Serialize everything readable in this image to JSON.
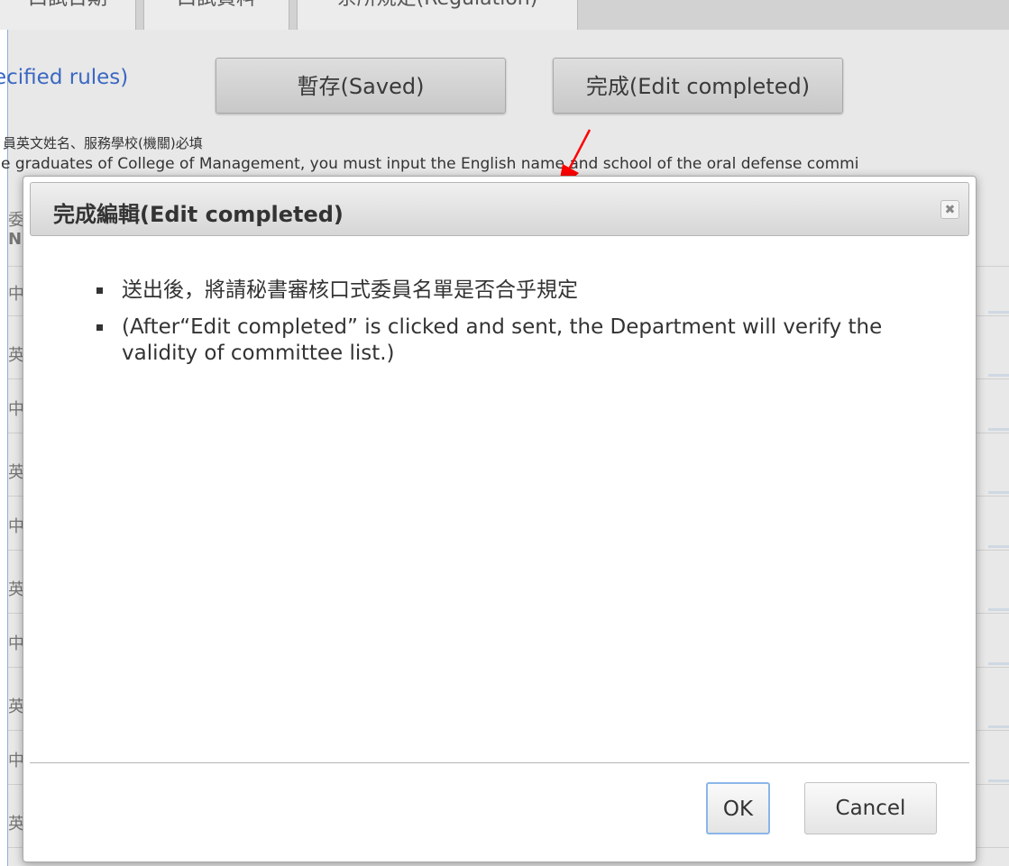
{
  "tabs": [
    {
      "label": "口試日期"
    },
    {
      "label": "口試資料"
    },
    {
      "label": "系所規定(Regulation)"
    }
  ],
  "top": {
    "rules_link": "ecified rules)",
    "saved_button": "暫存(Saved)",
    "edit_completed_button": "完成(Edit completed)",
    "note_zh": "員英文姓名、服務學校(機關)必填",
    "note_en": "e graduates of College of Management, you must input the English name and school of the oral defense commi"
  },
  "background_rows": [
    "中",
    "英",
    "中",
    "英",
    "中",
    "英",
    "中",
    "英",
    "中",
    "英"
  ],
  "background_header": [
    "委",
    "N"
  ],
  "dialog": {
    "title": "完成編輯(Edit completed)",
    "close_icon": "close-x-icon",
    "items": [
      "送出後，將請秘書審核口式委員名單是否合乎規定",
      "(After“Edit completed” is clicked and sent, the Department will verify the validity of committee list.)"
    ],
    "ok_label": "OK",
    "cancel_label": "Cancel"
  },
  "colors": {
    "link": "#3a67c2",
    "annotation_arrow": "#ff0000",
    "ok_focus": "#8ab6e8"
  }
}
